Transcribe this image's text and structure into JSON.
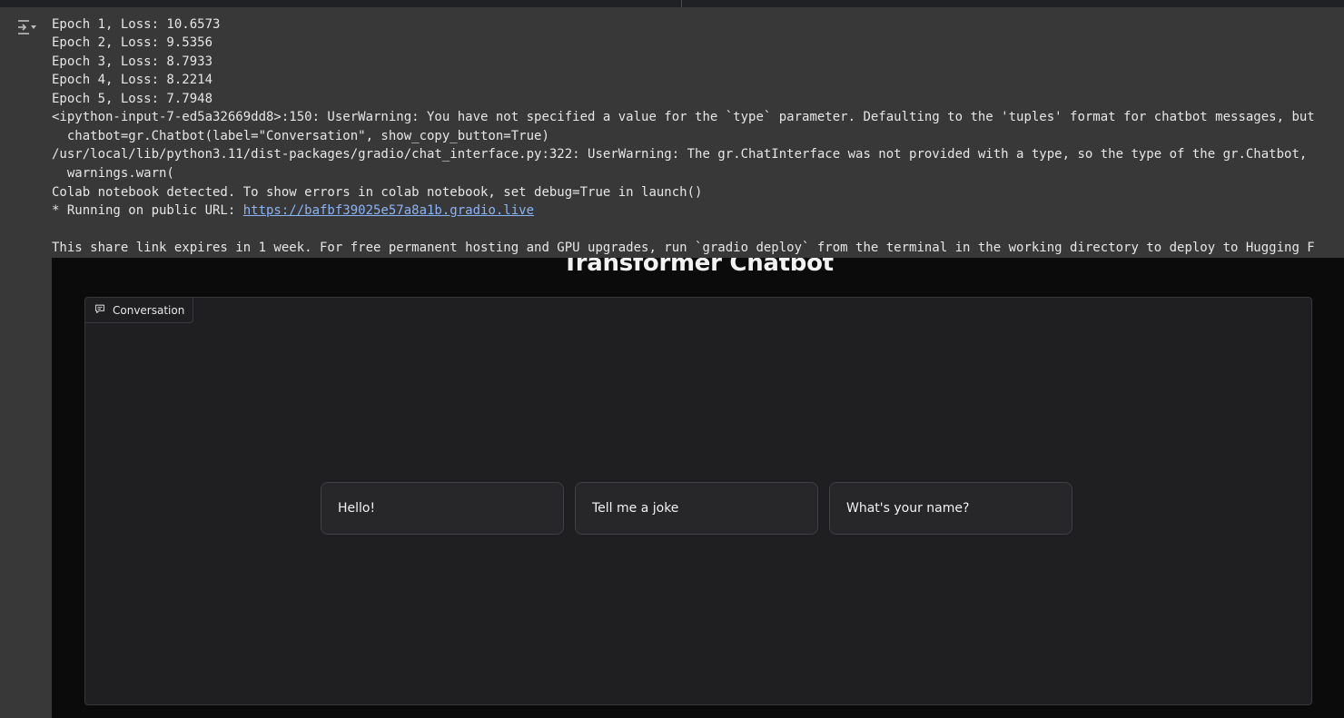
{
  "notebook": {
    "output_lines": [
      "Epoch 1, Loss: 10.6573",
      "Epoch 2, Loss: 9.5356",
      "Epoch 3, Loss: 8.7933",
      "Epoch 4, Loss: 8.2214",
      "Epoch 5, Loss: 7.7948",
      "<ipython-input-7-ed5a32669dd8>:150: UserWarning: You have not specified a value for the `type` parameter. Defaulting to the 'tuples' format for chatbot messages, but",
      "  chatbot=gr.Chatbot(label=\"Conversation\", show_copy_button=True)",
      "/usr/local/lib/python3.11/dist-packages/gradio/chat_interface.py:322: UserWarning: The gr.ChatInterface was not provided with a type, so the type of the gr.Chatbot,",
      "  warnings.warn(",
      "Colab notebook detected. To show errors in colab notebook, set debug=True in launch()"
    ],
    "public_url_prefix": "* Running on public URL: ",
    "public_url": "https://bafbf39025e57a8a1b.gradio.live",
    "share_notice": "This share link expires in 1 week. For free permanent hosting and GPU upgrades, run `gradio deploy` from the terminal in the working directory to deploy to Hugging F"
  },
  "gradio": {
    "title": "Transformer Chatbot",
    "chatbot_label": "Conversation",
    "examples": [
      "Hello!",
      "Tell me a joke",
      "What's your name?"
    ]
  }
}
